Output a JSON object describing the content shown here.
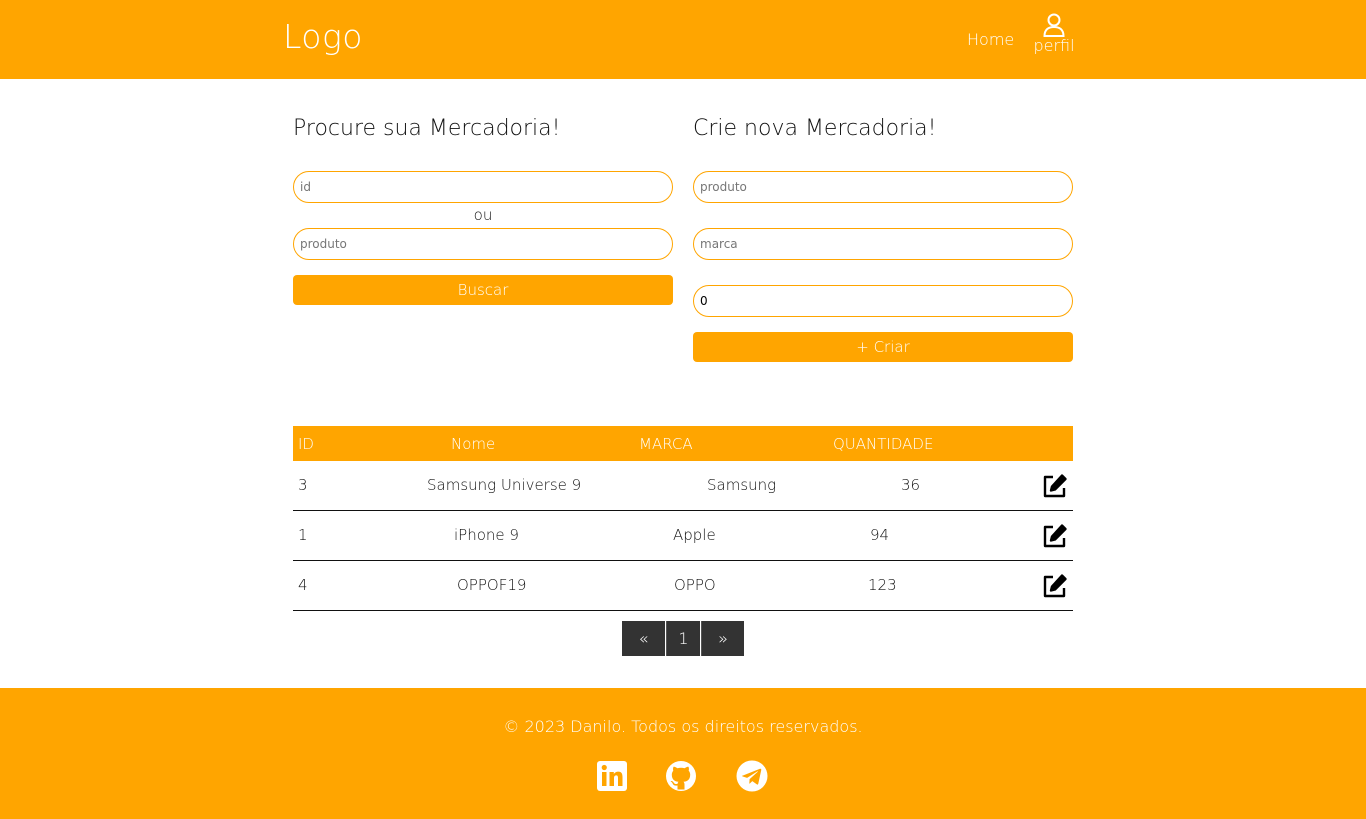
{
  "header": {
    "logo": "Logo",
    "nav_home": "Home",
    "nav_perfil": "perfil"
  },
  "search": {
    "title": "Procure sua Mercadoria!",
    "id_placeholder": "id",
    "or_label": "ou",
    "product_placeholder": "produto",
    "button": "Buscar"
  },
  "create": {
    "title": "Crie nova Mercadoria!",
    "product_placeholder": "produto",
    "brand_placeholder": "marca",
    "quantity_value": "0",
    "button": "+ Criar"
  },
  "table": {
    "headers": [
      "ID",
      "Nome",
      "MARCA",
      "QUANTIDADE"
    ],
    "rows": [
      {
        "id": "3",
        "nome": "Samsung Universe 9",
        "marca": "Samsung",
        "quantidade": "36"
      },
      {
        "id": "1",
        "nome": "iPhone 9",
        "marca": "Apple",
        "quantidade": "94"
      },
      {
        "id": "4",
        "nome": "OPPOF19",
        "marca": "OPPO",
        "quantidade": "123"
      }
    ]
  },
  "pagination": {
    "prev": "«",
    "page": "1",
    "next": "»"
  },
  "footer": {
    "copyright": "© 2023 Danilo. Todos os direitos reservados.",
    "social": [
      "linkedin-icon",
      "github-icon",
      "telegram-icon"
    ]
  },
  "colors": {
    "accent": "#ffa500",
    "pager_bg": "#333333"
  }
}
